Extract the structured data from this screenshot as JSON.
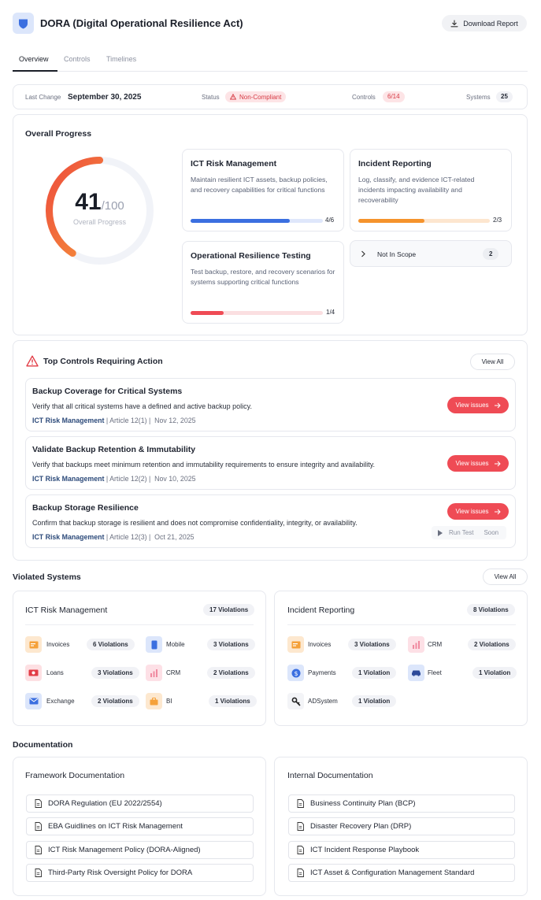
{
  "header": {
    "title": "DORA (Digital Operational Resilience Act)",
    "download_label": "Download Report"
  },
  "tabs": [
    {
      "label": "Overview",
      "active": true
    },
    {
      "label": "Controls",
      "active": false
    },
    {
      "label": "Timelines",
      "active": false
    }
  ],
  "summary": {
    "last_change_label": "Last Change",
    "last_change_value": "September 30, 2025",
    "status_label": "Status",
    "status_value": "Non-Compliant",
    "controls_label": "Controls",
    "controls_value": "6/14",
    "systems_label": "Systems",
    "systems_value": "25"
  },
  "progress": {
    "section_title": "Overall Progress",
    "score": "41",
    "total": "/100",
    "caption": "Overall Progress",
    "score_fraction": 0.41,
    "categories": [
      {
        "title": "ICT Risk Management",
        "desc": "Maintain resilient ICT assets, backup policies, and recovery capabilities for critical functions",
        "count": "4/6",
        "fraction": 0.667,
        "color": "#3b6fe0",
        "track": "#dfe7fb"
      },
      {
        "title": "Incident Reporting",
        "desc": "Log, classify, and evidence ICT-related incidents impacting availability and recoverability",
        "count": "2/3",
        "fraction": 0.5,
        "color": "#f5932c",
        "track": "#fde6cf"
      },
      {
        "title": "Operational Resilience Testing",
        "desc": "Test backup, restore, and recovery scenarios for systems supporting critical functions",
        "count": "1/4",
        "fraction": 0.25,
        "color": "#ef4b55",
        "track": "#fbdfe1"
      }
    ],
    "not_in_scope_label": "Not In Scope",
    "not_in_scope_count": "2"
  },
  "top_controls": {
    "title": "Top Controls Requiring Action",
    "view_all": "View All",
    "items": [
      {
        "title": "Backup Coverage for Critical Systems",
        "desc": "Verify that all critical systems have a defined and active backup policy.",
        "category": "ICT Risk Management",
        "article": "Article 12(1)",
        "date": "Nov 12, 2025",
        "button": "View issues"
      },
      {
        "title": "Validate Backup Retention & Immutability",
        "desc": "Verify that backups meet minimum retention and immutability requirements to ensure integrity and availability.",
        "category": "ICT Risk Management",
        "article": "Article 12(2)",
        "date": "Nov 10, 2025",
        "button": "View issues"
      },
      {
        "title": "Backup Storage Resilience",
        "desc": "Confirm that backup storage is resilient and does not compromise confidentiality, integrity, or availability.",
        "category": "ICT Risk Management",
        "article": "Article 12(3)",
        "date": "Oct 21, 2025",
        "button": "View issues",
        "run_test": "Run Test",
        "soon": "Soon"
      }
    ]
  },
  "violated": {
    "title": "Violated Systems",
    "view_all": "View All",
    "groups": [
      {
        "title": "ICT Risk Management",
        "badge": "17 Violations",
        "systems": [
          {
            "name": "Invoices",
            "count": "6 Violations"
          },
          {
            "name": "Mobile",
            "count": "3 Violations"
          },
          {
            "name": "Loans",
            "count": "3 Violations"
          },
          {
            "name": "CRM",
            "count": "2 Violations"
          },
          {
            "name": "Exchange",
            "count": "2 Violations"
          },
          {
            "name": "BI",
            "count": "1 Violations"
          }
        ]
      },
      {
        "title": "Incident Reporting",
        "badge": "8 Violations",
        "systems": [
          {
            "name": "Invoices",
            "count": "3 Violations"
          },
          {
            "name": "CRM",
            "count": "2 Violations"
          },
          {
            "name": "Payments",
            "count": "1 Violation"
          },
          {
            "name": "Fleet",
            "count": "1 Violation"
          },
          {
            "name": "ADSystem",
            "count": "1 Violation"
          }
        ]
      }
    ]
  },
  "documentation": {
    "title": "Documentation",
    "framework": {
      "title": "Framework Documentation",
      "items": [
        "DORA Regulation (EU 2022/2554)",
        "EBA Guidlines on ICT Risk Management",
        "ICT Risk Management Policy (DORA-Aligned)",
        "Third-Party Risk Oversight Policy for DORA"
      ]
    },
    "internal": {
      "title": "Internal Documentation",
      "items": [
        "Business Continuity Plan (BCP)",
        "Disaster Recovery Plan (DRP)",
        "ICT Incident Response Playbook",
        "ICT Asset & Configuration Management Standard"
      ]
    }
  },
  "colors": {
    "accent": "#3b6fe0",
    "danger": "#ef4b55",
    "warning": "#f5932c"
  }
}
